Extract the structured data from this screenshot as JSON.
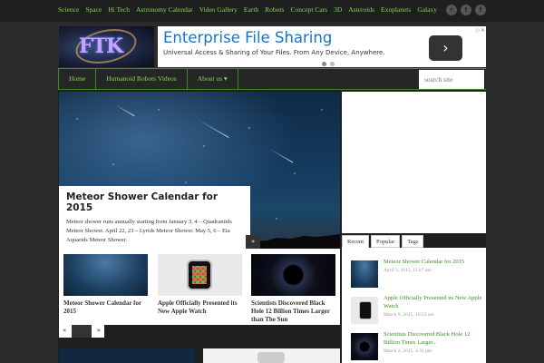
{
  "topnav": {
    "items": [
      "Science",
      "Space",
      "Hi Tech",
      "Astronomy Calendar",
      "Video Gallery",
      "Earth",
      "Robots",
      "Concept Cars",
      "3D",
      "Asteroids",
      "Exoplanets",
      "Galaxy"
    ]
  },
  "social": {
    "icons": [
      "rss-icon",
      "twitter-icon",
      "facebook-icon"
    ],
    "glyphs": [
      "r",
      "t",
      "f"
    ]
  },
  "logo": {
    "text": "FTK"
  },
  "ad": {
    "title": "Enterprise File Sharing",
    "subtitle": "Universal Access & Sharing of Your Files. From Any Device, Anywhere.",
    "next_glyph": "›"
  },
  "mainnav": {
    "items": [
      "Home",
      "Humanoid Robots Videos",
      "About us ▾"
    ],
    "search_placeholder": "search site"
  },
  "hero": {
    "title": "Meteor Shower Calendar for 2015",
    "excerpt": "Meteor shower runs annually starting from January 3, 4 – Quadrantids Meteor Shower. April 22, 23 – Lyrids Meteor Shower. May 5, 6 – Eta Aquarids Meteor Shower.",
    "arrow": "»"
  },
  "thumbs": [
    {
      "title": "Meteor Shower Calendar for 2015"
    },
    {
      "title": "Apple Officially Presented its New Apple Watch"
    },
    {
      "title": "Scientists Discovered Black Hole 12 Billion Times Larger than The Sun"
    }
  ],
  "pager": {
    "prev": "«",
    "next": "»"
  },
  "sidebar": {
    "tabs": [
      "Recent",
      "Popular",
      "Tags"
    ],
    "posts": [
      {
        "title": "Meteor Shower Calendar for 2015",
        "date": "April 3, 2015, 11:47 am"
      },
      {
        "title": "Apple Officially Presented its New Apple Watch",
        "date": "March 9, 2015, 10:53 am"
      },
      {
        "title": "Scientists Discovered Black Hole 12 Billion Times Larger...",
        "date": "March 2, 2015, 4:31 pm"
      }
    ]
  },
  "colors": {
    "accent": "#7ed957",
    "link_green": "#3b8a2b",
    "background": "#2b2b2b"
  }
}
